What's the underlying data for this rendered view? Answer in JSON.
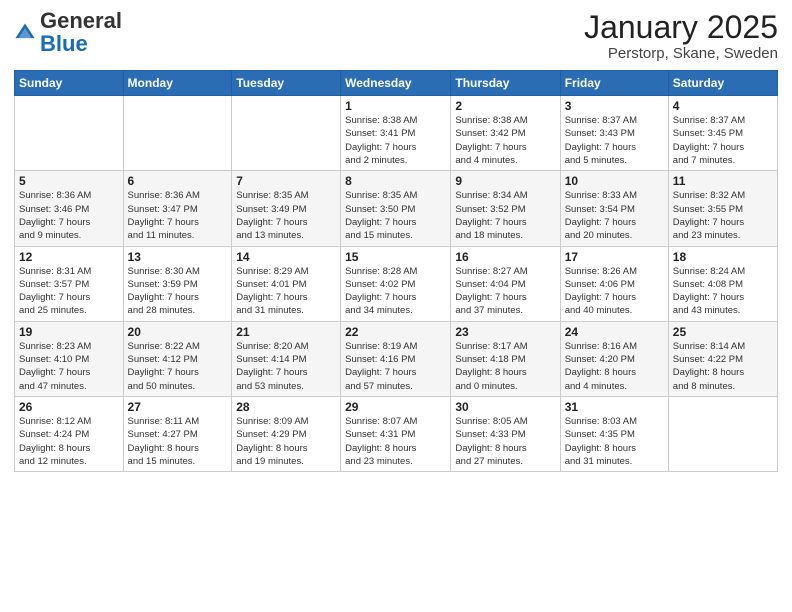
{
  "header": {
    "logo_general": "General",
    "logo_blue": "Blue",
    "month_title": "January 2025",
    "location": "Perstorp, Skane, Sweden"
  },
  "weekdays": [
    "Sunday",
    "Monday",
    "Tuesday",
    "Wednesday",
    "Thursday",
    "Friday",
    "Saturday"
  ],
  "weeks": [
    [
      {
        "day": "",
        "info": ""
      },
      {
        "day": "",
        "info": ""
      },
      {
        "day": "",
        "info": ""
      },
      {
        "day": "1",
        "info": "Sunrise: 8:38 AM\nSunset: 3:41 PM\nDaylight: 7 hours\nand 2 minutes."
      },
      {
        "day": "2",
        "info": "Sunrise: 8:38 AM\nSunset: 3:42 PM\nDaylight: 7 hours\nand 4 minutes."
      },
      {
        "day": "3",
        "info": "Sunrise: 8:37 AM\nSunset: 3:43 PM\nDaylight: 7 hours\nand 5 minutes."
      },
      {
        "day": "4",
        "info": "Sunrise: 8:37 AM\nSunset: 3:45 PM\nDaylight: 7 hours\nand 7 minutes."
      }
    ],
    [
      {
        "day": "5",
        "info": "Sunrise: 8:36 AM\nSunset: 3:46 PM\nDaylight: 7 hours\nand 9 minutes."
      },
      {
        "day": "6",
        "info": "Sunrise: 8:36 AM\nSunset: 3:47 PM\nDaylight: 7 hours\nand 11 minutes."
      },
      {
        "day": "7",
        "info": "Sunrise: 8:35 AM\nSunset: 3:49 PM\nDaylight: 7 hours\nand 13 minutes."
      },
      {
        "day": "8",
        "info": "Sunrise: 8:35 AM\nSunset: 3:50 PM\nDaylight: 7 hours\nand 15 minutes."
      },
      {
        "day": "9",
        "info": "Sunrise: 8:34 AM\nSunset: 3:52 PM\nDaylight: 7 hours\nand 18 minutes."
      },
      {
        "day": "10",
        "info": "Sunrise: 8:33 AM\nSunset: 3:54 PM\nDaylight: 7 hours\nand 20 minutes."
      },
      {
        "day": "11",
        "info": "Sunrise: 8:32 AM\nSunset: 3:55 PM\nDaylight: 7 hours\nand 23 minutes."
      }
    ],
    [
      {
        "day": "12",
        "info": "Sunrise: 8:31 AM\nSunset: 3:57 PM\nDaylight: 7 hours\nand 25 minutes."
      },
      {
        "day": "13",
        "info": "Sunrise: 8:30 AM\nSunset: 3:59 PM\nDaylight: 7 hours\nand 28 minutes."
      },
      {
        "day": "14",
        "info": "Sunrise: 8:29 AM\nSunset: 4:01 PM\nDaylight: 7 hours\nand 31 minutes."
      },
      {
        "day": "15",
        "info": "Sunrise: 8:28 AM\nSunset: 4:02 PM\nDaylight: 7 hours\nand 34 minutes."
      },
      {
        "day": "16",
        "info": "Sunrise: 8:27 AM\nSunset: 4:04 PM\nDaylight: 7 hours\nand 37 minutes."
      },
      {
        "day": "17",
        "info": "Sunrise: 8:26 AM\nSunset: 4:06 PM\nDaylight: 7 hours\nand 40 minutes."
      },
      {
        "day": "18",
        "info": "Sunrise: 8:24 AM\nSunset: 4:08 PM\nDaylight: 7 hours\nand 43 minutes."
      }
    ],
    [
      {
        "day": "19",
        "info": "Sunrise: 8:23 AM\nSunset: 4:10 PM\nDaylight: 7 hours\nand 47 minutes."
      },
      {
        "day": "20",
        "info": "Sunrise: 8:22 AM\nSunset: 4:12 PM\nDaylight: 7 hours\nand 50 minutes."
      },
      {
        "day": "21",
        "info": "Sunrise: 8:20 AM\nSunset: 4:14 PM\nDaylight: 7 hours\nand 53 minutes."
      },
      {
        "day": "22",
        "info": "Sunrise: 8:19 AM\nSunset: 4:16 PM\nDaylight: 7 hours\nand 57 minutes."
      },
      {
        "day": "23",
        "info": "Sunrise: 8:17 AM\nSunset: 4:18 PM\nDaylight: 8 hours\nand 0 minutes."
      },
      {
        "day": "24",
        "info": "Sunrise: 8:16 AM\nSunset: 4:20 PM\nDaylight: 8 hours\nand 4 minutes."
      },
      {
        "day": "25",
        "info": "Sunrise: 8:14 AM\nSunset: 4:22 PM\nDaylight: 8 hours\nand 8 minutes."
      }
    ],
    [
      {
        "day": "26",
        "info": "Sunrise: 8:12 AM\nSunset: 4:24 PM\nDaylight: 8 hours\nand 12 minutes."
      },
      {
        "day": "27",
        "info": "Sunrise: 8:11 AM\nSunset: 4:27 PM\nDaylight: 8 hours\nand 15 minutes."
      },
      {
        "day": "28",
        "info": "Sunrise: 8:09 AM\nSunset: 4:29 PM\nDaylight: 8 hours\nand 19 minutes."
      },
      {
        "day": "29",
        "info": "Sunrise: 8:07 AM\nSunset: 4:31 PM\nDaylight: 8 hours\nand 23 minutes."
      },
      {
        "day": "30",
        "info": "Sunrise: 8:05 AM\nSunset: 4:33 PM\nDaylight: 8 hours\nand 27 minutes."
      },
      {
        "day": "31",
        "info": "Sunrise: 8:03 AM\nSunset: 4:35 PM\nDaylight: 8 hours\nand 31 minutes."
      },
      {
        "day": "",
        "info": ""
      }
    ]
  ]
}
